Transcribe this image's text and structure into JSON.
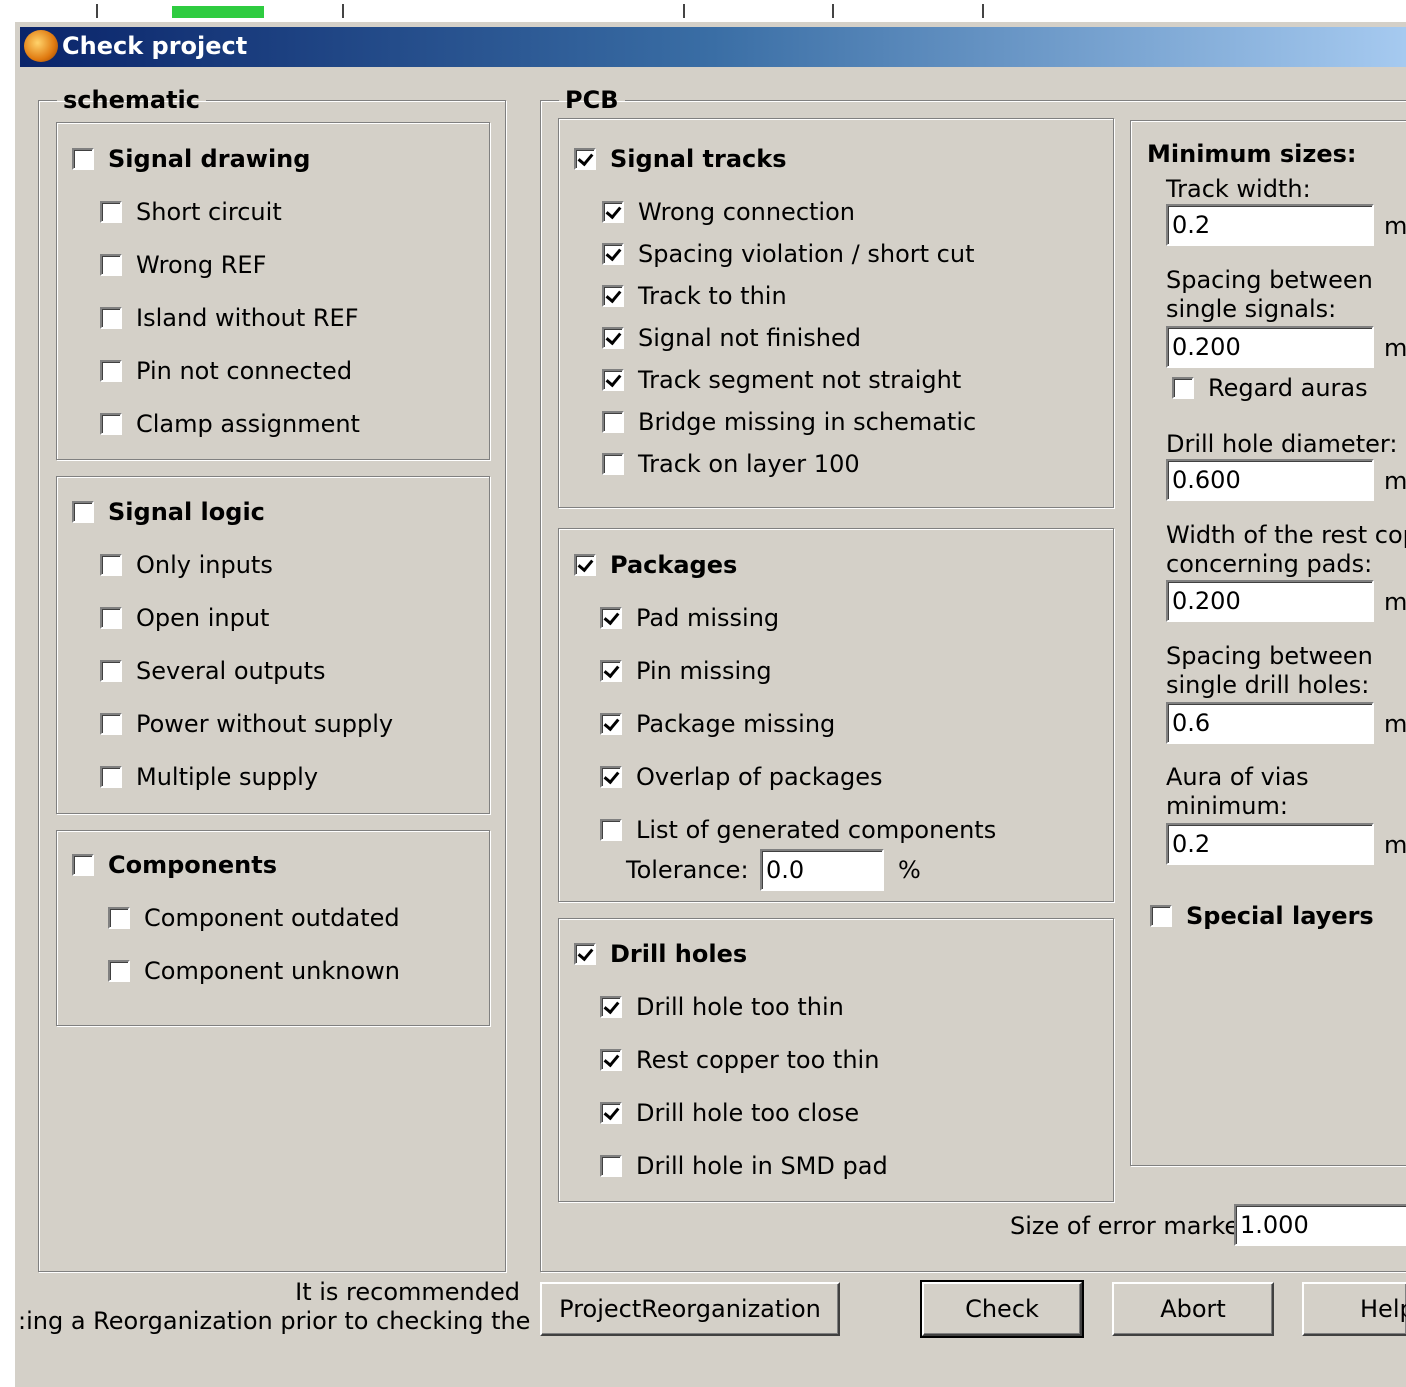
{
  "window": {
    "title": "Check project"
  },
  "schematic": {
    "legend": "schematic",
    "signal_drawing": {
      "label": "Signal drawing",
      "checked": false,
      "items": [
        {
          "label": "Short circuit",
          "checked": false
        },
        {
          "label": "Wrong REF",
          "checked": false
        },
        {
          "label": "Island without REF",
          "checked": false
        },
        {
          "label": "Pin not connected",
          "checked": false
        },
        {
          "label": "Clamp assignment",
          "checked": false
        }
      ]
    },
    "signal_logic": {
      "label": "Signal logic",
      "checked": false,
      "items": [
        {
          "label": "Only inputs",
          "checked": false
        },
        {
          "label": "Open input",
          "checked": false
        },
        {
          "label": "Several outputs",
          "checked": false
        },
        {
          "label": "Power without supply",
          "checked": false
        },
        {
          "label": "Multiple supply",
          "checked": false
        }
      ]
    },
    "components": {
      "label": "Components",
      "checked": false,
      "items": [
        {
          "label": "Component outdated",
          "checked": false
        },
        {
          "label": "Component unknown",
          "checked": false
        }
      ]
    }
  },
  "pcb": {
    "legend": "PCB",
    "signal_tracks": {
      "label": "Signal tracks",
      "checked": true,
      "items": [
        {
          "label": "Wrong connection",
          "checked": true
        },
        {
          "label": "Spacing violation / short cut",
          "checked": true
        },
        {
          "label": "Track to thin",
          "checked": true
        },
        {
          "label": "Signal not finished",
          "checked": true
        },
        {
          "label": "Track segment not straight",
          "checked": true
        },
        {
          "label": "Bridge missing in schematic",
          "checked": false
        },
        {
          "label": "Track on layer 100",
          "checked": false
        }
      ]
    },
    "packages": {
      "label": "Packages",
      "checked": true,
      "items": [
        {
          "label": "Pad missing",
          "checked": true
        },
        {
          "label": "Pin missing",
          "checked": true
        },
        {
          "label": "Package missing",
          "checked": true
        },
        {
          "label": "Overlap of packages",
          "checked": true
        },
        {
          "label": "List of generated components",
          "checked": false
        }
      ],
      "tolerance_label": "Tolerance:",
      "tolerance_value": "0.0",
      "tolerance_unit": "%"
    },
    "drill_holes": {
      "label": "Drill holes",
      "checked": true,
      "items": [
        {
          "label": "Drill hole too thin",
          "checked": true
        },
        {
          "label": "Rest copper too thin",
          "checked": true
        },
        {
          "label": "Drill hole too close",
          "checked": true
        },
        {
          "label": "Drill hole in SMD pad",
          "checked": false
        }
      ]
    },
    "minimum_sizes": {
      "title": "Minimum sizes:",
      "track_width_label": "Track width:",
      "track_width": "0.2",
      "spacing_signals_label_1": "Spacing between",
      "spacing_signals_label_2": "single signals:",
      "spacing_signals": "0.200",
      "regard_auras": {
        "label": "Regard auras",
        "checked": false
      },
      "drill_diameter_label": "Drill hole diameter:",
      "drill_diameter": "0.600",
      "rest_copper_label_1": "Width of the rest coppe",
      "rest_copper_label_2": "concerning pads:",
      "rest_copper": "0.200",
      "spacing_drill_label_1": "Spacing between",
      "spacing_drill_label_2": "single drill holes:",
      "spacing_drill": "0.6",
      "aura_vias_label_1": "Aura of vias",
      "aura_vias_label_2": "minimum:",
      "aura_vias": "0.2",
      "unit": "mı"
    },
    "special_layers": {
      "label": "Special layers",
      "checked": false
    },
    "error_markers_label": "Size of error markers:",
    "error_markers_value": "1.000"
  },
  "footer": {
    "hint_line_1": "It is recommended",
    "hint_line_2": ":ing a Reorganization prior to checking the project",
    "reorg_button": "ProjectReorganization",
    "check_button": "Check",
    "abort_button": "Abort",
    "help_button": "Help"
  },
  "colors": {
    "title_start": "#0a246a",
    "title_end": "#a6caf0",
    "dialog_bg": "#d4d0c8",
    "progress_green": "#2ecc40"
  }
}
